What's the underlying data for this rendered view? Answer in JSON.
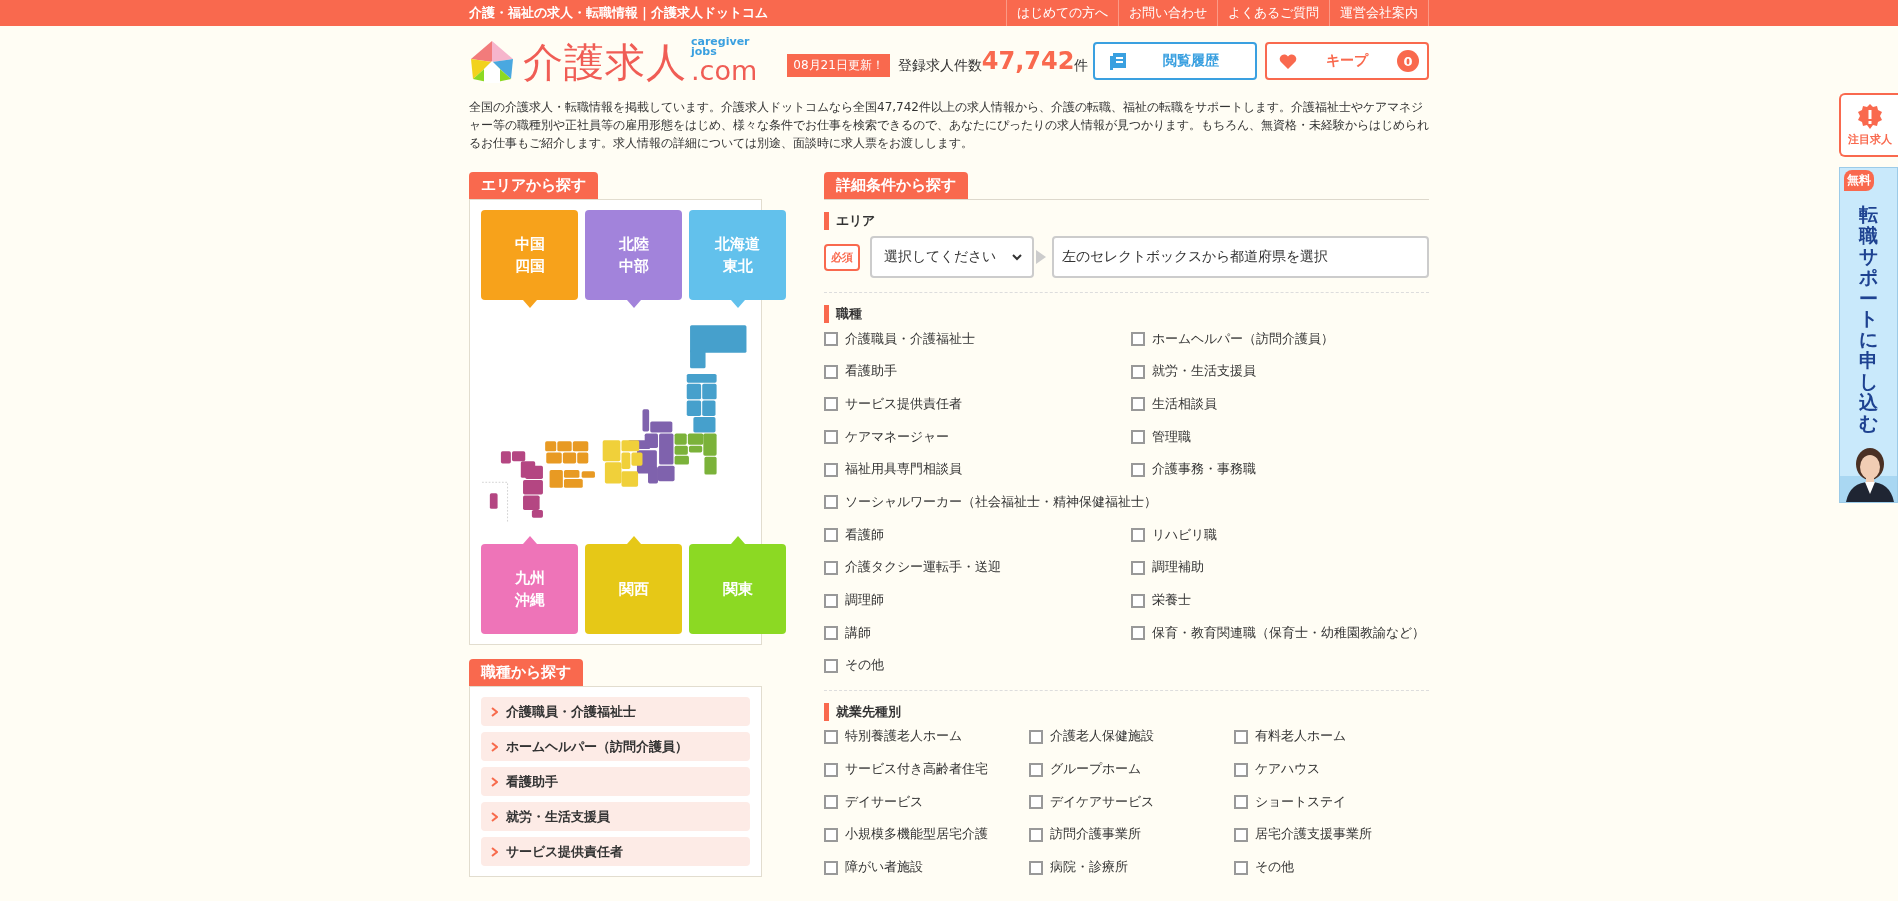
{
  "top_bar": {
    "tagline": "介護・福祉の求人・転職情報｜介護求人ドットコム",
    "links": [
      "はじめての方へ",
      "お問い合わせ",
      "よくあるご質問",
      "運営会社案内"
    ]
  },
  "logo": {
    "main": "介護求人",
    "sub": "caregiver\njobs",
    "domain": ".com"
  },
  "header": {
    "update_badge": "08月21日更新！",
    "count_label": "登録求人件数",
    "count": "47,742",
    "count_unit": "件",
    "history_button": "閲覧履歴",
    "keep_button": {
      "label": "キープ",
      "count": "0"
    }
  },
  "intro": "全国の介護求人・転職情報を掲載しています。介護求人ドットコムなら全国47,742件以上の求人情報から、介護の転職、福祉の転職をサポートします。介護福祉士やケアマネジャー等の職種別や正社員等の雇用形態をはじめ、様々な条件でお仕事を検索できるので、あなたにぴったりの求人情報が見つかります。もちろん、無資格・未経験からはじめられるお仕事もご紹介します。求人情報の詳細については別途、面談時に求人票をお渡しします。",
  "area_search": {
    "title": "エリアから探す",
    "regions_top": [
      {
        "label": "中国四国",
        "color": "#f7a21b"
      },
      {
        "label": "北陸中部",
        "color": "#a283db"
      },
      {
        "label": "北海道東北",
        "color": "#62c1ec"
      }
    ],
    "regions_bottom": [
      {
        "label": "九州沖縄",
        "color": "#ee74b8"
      },
      {
        "label": "関西",
        "color": "#e6c817"
      },
      {
        "label": "関東",
        "color": "#8cd923"
      }
    ]
  },
  "job_search": {
    "title": "職種から探す",
    "items": [
      "介護職員・介護福祉士",
      "ホームヘルパー（訪問介護員）",
      "看護助手",
      "就労・生活支援員",
      "サービス提供責任者"
    ]
  },
  "detail_search": {
    "title": "詳細条件から探す",
    "area": {
      "label": "エリア",
      "required_badge": "必須",
      "select_value": "選択してください",
      "hint": "左のセレクトボックスから都道府県を選択"
    },
    "job_types": {
      "label": "職種",
      "options": [
        {
          "label": "介護職員・介護福祉士",
          "checked": false,
          "kind": "normal"
        },
        {
          "label": "ホームヘルパー（訪問介護員）",
          "checked": false,
          "kind": "normal"
        },
        {
          "label": "看護助手",
          "checked": false,
          "kind": "normal"
        },
        {
          "label": "就労・生活支援員",
          "checked": false,
          "kind": "normal"
        },
        {
          "label": "サービス提供責任者",
          "checked": false,
          "kind": "normal"
        },
        {
          "label": "生活相談員",
          "checked": false,
          "kind": "normal"
        },
        {
          "label": "ケアマネージャー",
          "checked": false,
          "kind": "normal"
        },
        {
          "label": "管理職",
          "checked": false,
          "kind": "normal"
        },
        {
          "label": "福祉用具専門相談員",
          "checked": false,
          "kind": "normal"
        },
        {
          "label": "介護事務・事務職",
          "checked": false,
          "kind": "normal"
        },
        {
          "label": "ソーシャルワーカー（社会福祉士・精神保健福祉士）",
          "checked": false,
          "kind": "wide"
        },
        {
          "label": "看護師",
          "checked": false,
          "kind": "normal"
        },
        {
          "label": "リハビリ職",
          "checked": false,
          "kind": "normal"
        },
        {
          "label": "介護タクシー運転手・送迎",
          "checked": false,
          "kind": "normal"
        },
        {
          "label": "調理補助",
          "checked": false,
          "kind": "normal"
        },
        {
          "label": "調理師",
          "checked": false,
          "kind": "normal"
        },
        {
          "label": "栄養士",
          "checked": false,
          "kind": "normal"
        },
        {
          "label": "講師",
          "checked": false,
          "kind": "normal"
        },
        {
          "label": "保育・教育関連職（保育士・幼稚園教諭など）",
          "checked": false,
          "kind": "normal"
        },
        {
          "label": "その他",
          "checked": false,
          "kind": "normal"
        }
      ]
    },
    "facility_types": {
      "label": "就業先種別",
      "options": [
        {
          "label": "特別養護老人ホーム",
          "checked": false
        },
        {
          "label": "介護老人保健施設",
          "checked": false
        },
        {
          "label": "有料老人ホーム",
          "checked": false
        },
        {
          "label": "サービス付き高齢者住宅",
          "checked": false
        },
        {
          "label": "グループホーム",
          "checked": false
        },
        {
          "label": "ケアハウス",
          "checked": false
        },
        {
          "label": "デイサービス",
          "checked": false
        },
        {
          "label": "デイケアサービス",
          "checked": false
        },
        {
          "label": "ショートステイ",
          "checked": false
        },
        {
          "label": "小規模多機能型居宅介護",
          "checked": false
        },
        {
          "label": "訪問介護事業所",
          "checked": false
        },
        {
          "label": "居宅介護支援事業所",
          "checked": false
        },
        {
          "label": "障がい者施設",
          "checked": false
        },
        {
          "label": "病院・診療所",
          "checked": false
        },
        {
          "label": "その他",
          "checked": false
        }
      ]
    }
  },
  "side": {
    "featured": "注目求人",
    "banner": {
      "badge": "無料",
      "text": "転職サポートに申し込む"
    }
  }
}
